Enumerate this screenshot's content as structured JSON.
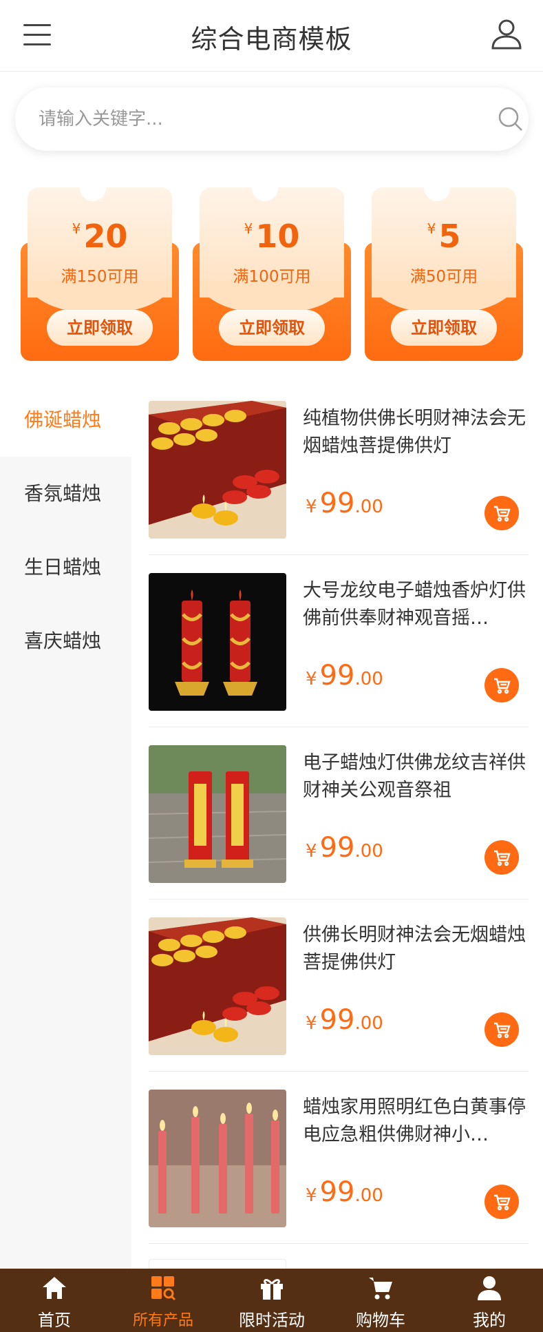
{
  "header": {
    "title": "综合电商模板",
    "menu_icon": "menu-icon",
    "user_icon": "user-icon"
  },
  "search": {
    "placeholder": "请输入关键字...",
    "icon": "search-icon"
  },
  "coupons": [
    {
      "currency": "¥",
      "amount": "20",
      "condition": "满150可用",
      "button": "立即领取"
    },
    {
      "currency": "¥",
      "amount": "10",
      "condition": "满100可用",
      "button": "立即领取"
    },
    {
      "currency": "¥",
      "amount": "5",
      "condition": "满50可用",
      "button": "立即领取"
    }
  ],
  "categories": [
    {
      "label": "佛诞蜡烛",
      "active": true
    },
    {
      "label": "香氛蜡烛",
      "active": false
    },
    {
      "label": "生日蜡烛",
      "active": false
    },
    {
      "label": "喜庆蜡烛",
      "active": false
    }
  ],
  "products": [
    {
      "name": "纯植物供佛长明财神法会无烟蜡烛菩提佛供灯",
      "currency": "¥",
      "price_int": "99",
      "price_dec": ".00",
      "image": "tealight-candles-box"
    },
    {
      "name": "大号龙纹电子蜡烛香炉灯供佛前供奉财神观音摇…",
      "currency": "¥",
      "price_int": "99",
      "price_dec": ".00",
      "image": "dragon-pillar-candles"
    },
    {
      "name": "电子蜡烛灯供佛龙纹吉祥供财神关公观音祭祖",
      "currency": "¥",
      "price_int": "99",
      "price_dec": ".00",
      "image": "red-pillar-candles-outdoor"
    },
    {
      "name": "供佛长明财神法会无烟蜡烛菩提佛供灯",
      "currency": "¥",
      "price_int": "99",
      "price_dec": ".00",
      "image": "tealight-candles-box"
    },
    {
      "name": "蜡烛家用照明红色白黄事停电应急粗供佛财神小…",
      "currency": "¥",
      "price_int": "99",
      "price_dec": ".00",
      "image": "red-stick-candles"
    }
  ],
  "tabbar": [
    {
      "label": "首页",
      "icon": "home-icon",
      "active": false
    },
    {
      "label": "所有产品",
      "icon": "grid-search-icon",
      "active": true
    },
    {
      "label": "限时活动",
      "icon": "gift-icon",
      "active": false
    },
    {
      "label": "购物车",
      "icon": "cart-icon",
      "active": false
    },
    {
      "label": "我的",
      "icon": "user-icon",
      "active": false
    }
  ],
  "colors": {
    "accent": "#ff6a12",
    "tabbar_bg": "#542f14",
    "active_text": "#ff7b1a"
  }
}
